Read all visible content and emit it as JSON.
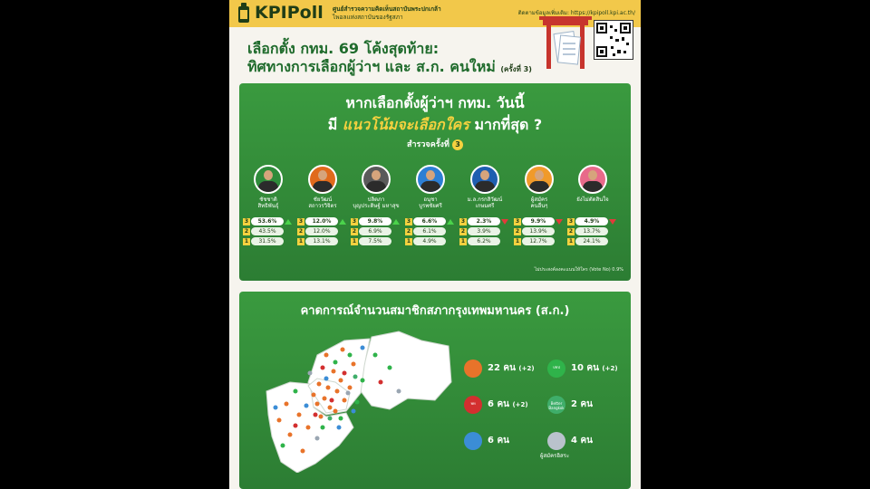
{
  "header": {
    "logo_text": "KPIPoll",
    "org_line1": "ศูนย์สำรวจความคิดเห็นสถาบันพระปกเกล้า",
    "org_line2": "ไพอลแห่งสถาบันของรัฐสภา",
    "more_info": "ติดตามข้อมูลเพิ่มเติม: https://kpipoll.kpi.ac.th/"
  },
  "title": {
    "line1": "เลือกตั้ง กทม. 69 โค้งสุดท้าย:",
    "line2": "ทิศทางการเลือกผู้ว่าฯ และ ส.ก. คนใหม่",
    "round": "(ครั้งที่ 3)"
  },
  "panel1": {
    "q1": "หากเลือกตั้งผู้ว่าฯ กทม. วันนี้",
    "q2_pre": "มี",
    "q2_highlight": "แนวโน้มจะเลือกใคร",
    "q2_post": "มากที่สุด ?",
    "survey_label": "สำรวจครั้งที่",
    "survey_num": "3",
    "vote_no": "ไม่ประสงค์ลงคะแนนให้ใคร (Vote No) 0.9%",
    "candidates": [
      {
        "name1": "ชัชชาติ",
        "name2": "สิทธิพันธุ์",
        "r3": "53.6%",
        "trend": "up",
        "r2": "43.5%",
        "r1": "31.5%",
        "color": "#2e8b3a"
      },
      {
        "name1": "ชัยวัฒน์",
        "name2": "สถาวรวิจิตร",
        "r3": "12.0%",
        "trend": "up",
        "r2": "12.0%",
        "r1": "13.1%",
        "color": "#e06a1c"
      },
      {
        "name1": "ปลิตภา",
        "name2": "บุญประดิษฐ์ มหาสุข",
        "r3": "9.8%",
        "trend": "up",
        "r2": "6.9%",
        "r1": "7.5%",
        "color": "#5a5a5a"
      },
      {
        "name1": "อนุชา",
        "name2": "บูรพชัยศรี",
        "r3": "6.6%",
        "trend": "up",
        "r2": "6.1%",
        "r1": "4.9%",
        "color": "#2d7fd4"
      },
      {
        "name1": "ม.ล.กรกสิวัฒน์",
        "name2": "เกษมศรี",
        "r3": "2.3%",
        "trend": "down",
        "r2": "3.9%",
        "r1": "6.2%",
        "color": "#1f5fb0"
      },
      {
        "name1": "ผู้สมัคร",
        "name2": "คนอื่นๆ",
        "r3": "9.9%",
        "trend": "down",
        "r2": "13.9%",
        "r1": "12.7%",
        "color": "#f09a2a"
      },
      {
        "name1": "ยังไม่ตัดสินใจ",
        "name2": "",
        "r3": "4.9%",
        "trend": "down",
        "r2": "13.7%",
        "r1": "24.1%",
        "color": "#e86a8a"
      }
    ]
  },
  "panel2": {
    "title": "คาดการณ์จำนวนสมาชิกสภากรุงเทพมหานคร (ส.ก.)",
    "parties": [
      {
        "count": "22 คน",
        "change": "(+2)",
        "color": "#e8732a",
        "icon": "people-party-icon",
        "label": ""
      },
      {
        "count": "10 คน",
        "change": "(+2)",
        "color": "#2fb34a",
        "icon": "democrat-party-icon",
        "label": "ปชป"
      },
      {
        "count": "6 คน",
        "change": "(+2)",
        "color": "#d32f2f",
        "icon": "pheu-thai-icon",
        "label": "พท"
      },
      {
        "count": "2 คน",
        "change": "",
        "color": "#3fae6a",
        "icon": "better-bangkok-icon",
        "label": "Better Bangkok"
      },
      {
        "count": "6 คน",
        "change": "",
        "color": "#3b8dd6",
        "icon": "palang-pracharath-icon",
        "label": ""
      },
      {
        "count": "4 คน",
        "change": "",
        "color": "#b9c2cc",
        "icon": "independent-icon",
        "label": "ผู้สมัครอิสระ"
      }
    ]
  }
}
